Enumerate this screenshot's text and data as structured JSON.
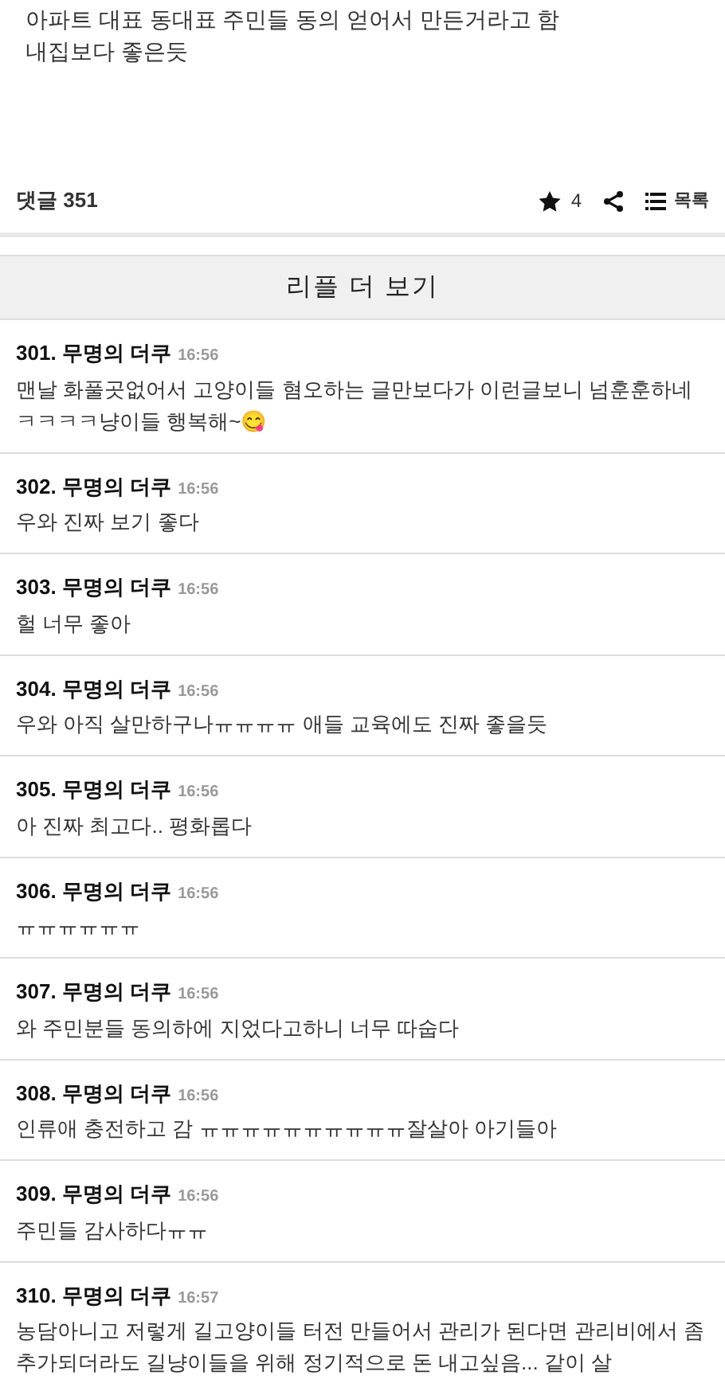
{
  "post": {
    "lines": [
      "아파트 대표 동대표 주민들 동의 얻어서 만든거라고 함",
      "내집보다 좋은듯"
    ]
  },
  "footer": {
    "comments_label": "댓글 351",
    "stars": "4",
    "list_label": "목록"
  },
  "more_button": "리플 더 보기",
  "comments": [
    {
      "number": "301.",
      "author": "무명의 더쿠",
      "time": "16:56",
      "text": "맨날 화풀곳없어서 고양이들 혐오하는 글만보다가 이런글보니 넘훈훈하네ㅋㅋㅋㅋ냥이들 행복해~😋"
    },
    {
      "number": "302.",
      "author": "무명의 더쿠",
      "time": "16:56",
      "text": "우와 진짜 보기 좋다"
    },
    {
      "number": "303.",
      "author": "무명의 더쿠",
      "time": "16:56",
      "text": "헐 너무 좋아"
    },
    {
      "number": "304.",
      "author": "무명의 더쿠",
      "time": "16:56",
      "text": "우와 아직 살만하구나ㅠㅠㅠㅠ 애들 교육에도 진짜 좋을듯"
    },
    {
      "number": "305.",
      "author": "무명의 더쿠",
      "time": "16:56",
      "text": "아 진짜 최고다.. 평화롭다"
    },
    {
      "number": "306.",
      "author": "무명의 더쿠",
      "time": "16:56",
      "text": "ㅠㅠㅠㅠㅠㅠ"
    },
    {
      "number": "307.",
      "author": "무명의 더쿠",
      "time": "16:56",
      "text": "와 주민분들 동의하에 지었다고하니 너무 따숩다"
    },
    {
      "number": "308.",
      "author": "무명의 더쿠",
      "time": "16:56",
      "text": "인류애 충전하고 감 ㅠㅠㅠㅠㅠㅠㅠㅠㅠㅠ잘살아 아기들아"
    },
    {
      "number": "309.",
      "author": "무명의 더쿠",
      "time": "16:56",
      "text": "주민들 감사하다ㅠㅠ"
    },
    {
      "number": "310.",
      "author": "무명의 더쿠",
      "time": "16:57",
      "text": "농담아니고 저렇게 길고양이들 터전 만들어서 관리가 된다면 관리비에서 좀 추가되더라도 길냥이들을 위해 정기적으로 돈 내고싶음... 같이 살"
    }
  ]
}
